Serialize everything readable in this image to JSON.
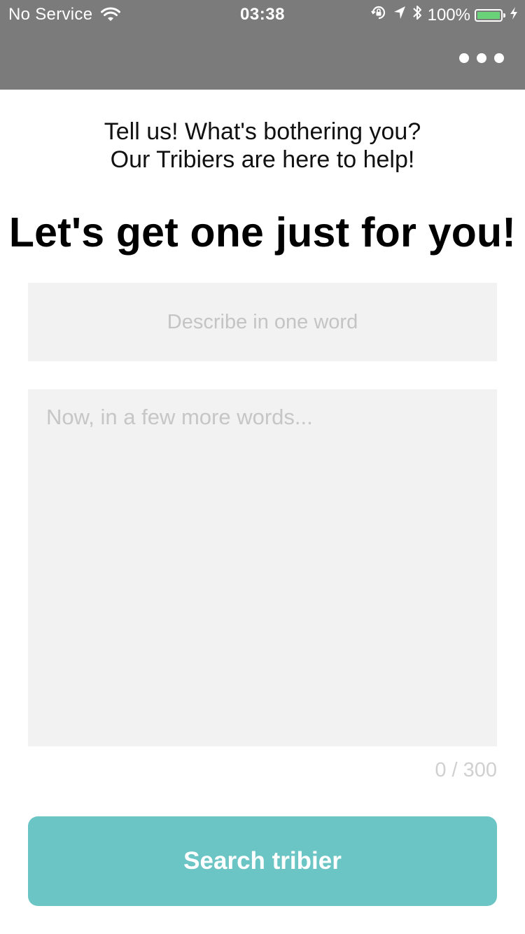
{
  "status_bar": {
    "carrier": "No Service",
    "time": "03:38",
    "battery_percent": "100%",
    "battery_color": "#6ad37a",
    "icons": [
      "wifi-icon",
      "orientation-lock-icon",
      "location-arrow-icon",
      "bluetooth-icon",
      "battery-icon",
      "charging-bolt-icon"
    ]
  },
  "header": {
    "background": "#7b7b7b",
    "more_icon": "more-dots-icon"
  },
  "intro": {
    "line1": "Tell us! What's bothering you?",
    "line2": "Our Tribiers are here to help!"
  },
  "headline": "Let's get one just for you!",
  "form": {
    "one_word_placeholder": "Describe in one word",
    "one_word_value": "",
    "more_words_placeholder": "Now, in a few more words...",
    "more_words_value": "",
    "counter": "0 / 300"
  },
  "submit": {
    "label": "Search tribier",
    "color": "#6cc5c5"
  }
}
